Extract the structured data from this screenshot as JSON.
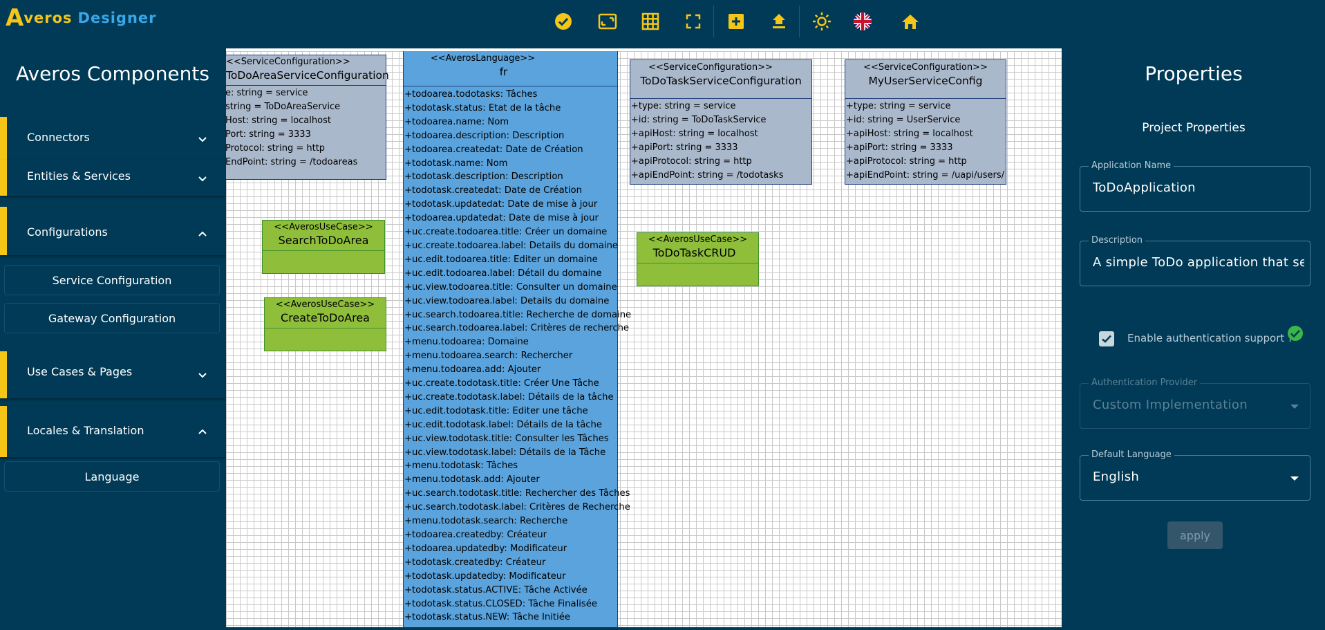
{
  "app": {
    "logo_letter": "A",
    "logo_text_1": "veros",
    "logo_text_2": "Designer"
  },
  "toolbar": {
    "icons": [
      "validate-icon",
      "resize-canvas-icon",
      "grid-icon",
      "fit-screen-icon",
      "add-icon",
      "upload-icon",
      "brightness-icon",
      "uk-flag-icon",
      "home-icon"
    ]
  },
  "sidebar": {
    "title": "Averos Components",
    "sections": [
      {
        "label": "Connectors",
        "expanded": false
      },
      {
        "label": "Entities & Services",
        "expanded": false
      },
      {
        "label": "Configurations",
        "expanded": true,
        "items": [
          "Service Configuration",
          "Gateway Configuration"
        ]
      },
      {
        "label": "Use Cases & Pages",
        "expanded": false
      },
      {
        "label": "Locales & Translation",
        "expanded": true,
        "items": [
          "Language"
        ]
      }
    ]
  },
  "canvas": {
    "classes": [
      {
        "stereotype": "<<ServiceConfiguration>>",
        "name": "ToDoAreaServiceConfiguration",
        "attributes": [
          "e: string = service",
          "string = ToDoAreaService",
          "Host: string = localhost",
          "Port: string = 3333",
          "Protocol: string = http",
          "EndPoint: string = /todoareas"
        ]
      },
      {
        "stereotype": "<<ServiceConfiguration>>",
        "name": "ToDoTaskServiceConfiguration",
        "attributes": [
          "+type: string = service",
          "+id: string = ToDoTaskService",
          "+apiHost: string = localhost",
          "+apiPort: string = 3333",
          "+apiProtocol: string = http",
          "+apiEndPoint: string = /todotasks"
        ]
      },
      {
        "stereotype": "<<ServiceConfiguration>>",
        "name": "MyUserServiceConfig",
        "attributes": [
          "+type: string = service",
          "+id: string = UserService",
          "+apiHost: string = localhost",
          "+apiPort: string = 3333",
          "+apiProtocol: string = http",
          "+apiEndPoint: string = /uapi/users/"
        ]
      }
    ],
    "usecases": [
      {
        "stereotype": "<<AverosUseCase>>",
        "name": "SearchToDoArea"
      },
      {
        "stereotype": "<<AverosUseCase>>",
        "name": "CreateToDoArea"
      },
      {
        "stereotype": "<<AverosUseCase>>",
        "name": "ToDoTaskCRUD"
      }
    ],
    "language": {
      "stereotype": "<<AverosLanguage>>",
      "name": "fr",
      "entries": [
        "+todoarea.todotasks: Tâches",
        "+todotask.status: Etat de la tâche",
        "+todoarea.name: Nom",
        "+todoarea.description: Description",
        "+todoarea.createdat: Date de Création",
        "+todotask.name: Nom",
        "+todotask.description: Description",
        "+todotask.createdat: Date de Création",
        "+todotask.updatedat: Date de mise à jour",
        "+todoarea.updatedat: Date de mise à jour",
        "+uc.create.todoarea.title: Créer un domaine",
        "+uc.create.todoarea.label: Details du domaine",
        "+uc.edit.todoarea.title: Editer un domaine",
        "+uc.edit.todoarea.label: Détail du domaine",
        "+uc.view.todoarea.title: Consulter un domaine",
        "+uc.view.todoarea.label: Details du domaine",
        "+uc.search.todoarea.title: Recherche de domaine",
        "+uc.search.todoarea.label: Critères de recherche",
        "+menu.todoarea: Domaine",
        "+menu.todoarea.search: Rechercher",
        "+menu.todoarea.add: Ajouter",
        "+uc.create.todotask.title: Créer Une Tâche",
        "+uc.create.todotask.label: Détails de la tâche",
        "+uc.edit.todotask.title: Editer une tâche",
        "+uc.edit.todotask.label: Détails de la tâche",
        "+uc.view.todotask.title: Consulter les Tâches",
        "+uc.view.todotask.label: Détails de la Tâche",
        "+menu.todotask: Tâches",
        "+menu.todotask.add: Ajouter",
        "+uc.search.todotask.title: Rechercher des Tâches",
        "+uc.search.todotask.label: Critères de Recherche",
        "+menu.todotask.search: Recherche",
        "+todoarea.createdby: Créateur",
        "+todoarea.updatedby: Modificateur",
        "+todotask.createdby: Créateur",
        "+todotask.updatedby: Modificateur",
        "+todotask.status.ACTIVE: Tâche Activée",
        "+todotask.status.CLOSED: Tâche Finalisée",
        "+todotask.status.NEW: Tâche Initiée"
      ]
    }
  },
  "properties": {
    "title": "Properties",
    "subtitle": "Project Properties",
    "application_name": {
      "label": "Application Name",
      "value": "ToDoApplication"
    },
    "description": {
      "label": "Description",
      "value": "A simple ToDo application that serves"
    },
    "auth_checkbox": {
      "label": "Enable authentication support ?",
      "checked": true
    },
    "auth_provider": {
      "label": "Authentication Provider",
      "value": "Custom Implementation"
    },
    "default_language": {
      "label": "Default Language",
      "value": "English"
    },
    "apply_label": "apply"
  },
  "colors": {
    "background": "#003a56",
    "accent": "#f5c518",
    "usecase": "#8fbf3a",
    "class_box": "#aab8cc",
    "language_box": "#5aa3dd"
  }
}
